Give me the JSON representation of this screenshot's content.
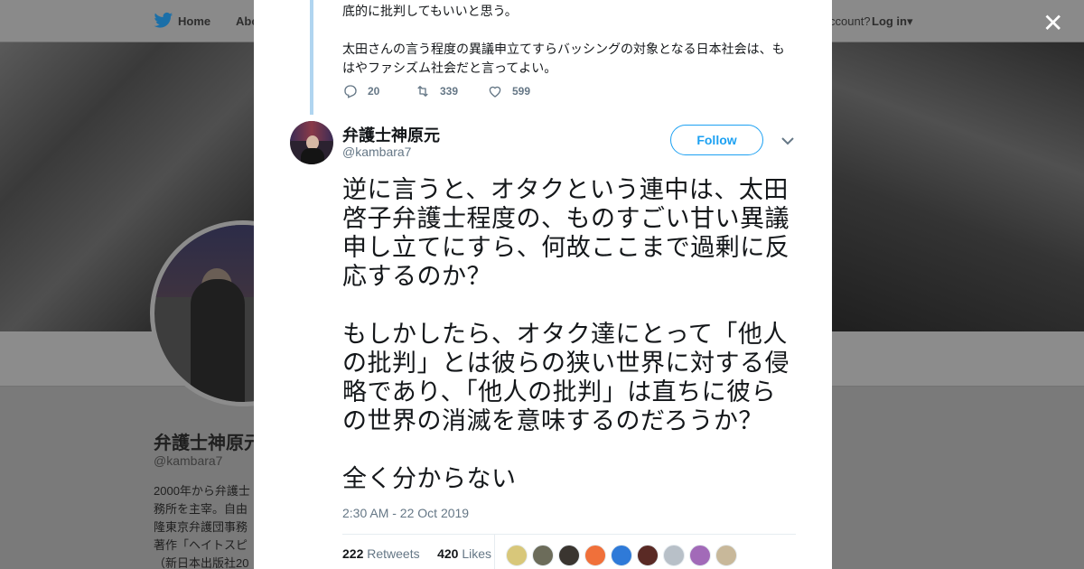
{
  "nav": {
    "home": "Home",
    "about": "Abo",
    "account": "ccount?",
    "login": "Log in"
  },
  "profile": {
    "name": "弁護士神原元",
    "handle": "@kambara7",
    "bio": "2000年から弁護士\n務所を主宰。自由\n隆東京弁護団事務\n著作「ヘイトスピ\n（新日本出版社20"
  },
  "modal": {
    "close": "✕",
    "prev_tweet": {
      "text": "底的に批判してもいいと思う。\n\n太田さんの言う程度の異議申立てすらバッシングの対象となる日本社会は、もはやファシズム社会だと言ってよい。",
      "replies": "20",
      "retweets": "339",
      "likes": "599"
    },
    "tweet": {
      "name": "弁護士神原元",
      "handle": "@kambara7",
      "follow_label": "Follow",
      "text": "逆に言うと、オタクという連中は、太田啓子弁護士程度の、ものすごい甘い異議申し立てにすら、何故ここまで過剰に反応するのか？\n\nもしかしたら、オタク達にとって「他人の批判」とは彼らの狭い世界に対する侵略であり、「他人の批判」は直ちに彼らの世界の消滅を意味するのだろうか？\n\n全く分からない",
      "timestamp": "2:30 AM - 22 Oct 2019",
      "retweet_count": "222",
      "retweet_label": "Retweets",
      "like_count": "420",
      "like_label": "Likes"
    },
    "likers": [
      "#d8c77a",
      "#6c6c5a",
      "#3a3530",
      "#f0703a",
      "#2f7ad8",
      "#5a2a25",
      "#b8c0c8",
      "#a26ab8",
      "#c8b89a"
    ]
  },
  "colors": {
    "accent": "#1da1f2",
    "text": "#14171a",
    "muted": "#657786",
    "thread": "#b0d5f0"
  }
}
